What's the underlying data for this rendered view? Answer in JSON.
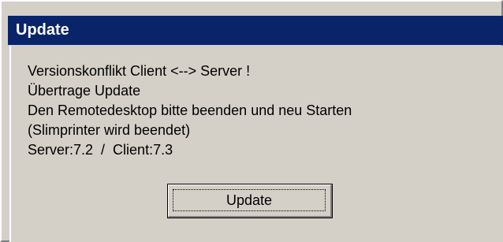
{
  "window": {
    "title": "Update"
  },
  "message": {
    "lines": [
      "Versionskonflikt Client <--> Server !",
      "Übertrage Update",
      "Den Remotedesktop bitte beenden und neu Starten",
      "(Slimprinter wird beendet)",
      "Server:7.2  /  Client:7.3"
    ]
  },
  "buttons": {
    "update_label": "Update"
  },
  "colors": {
    "titlebar": "#0a246a",
    "title_text": "#ffffff",
    "window_bg": "#d4d0c8"
  }
}
